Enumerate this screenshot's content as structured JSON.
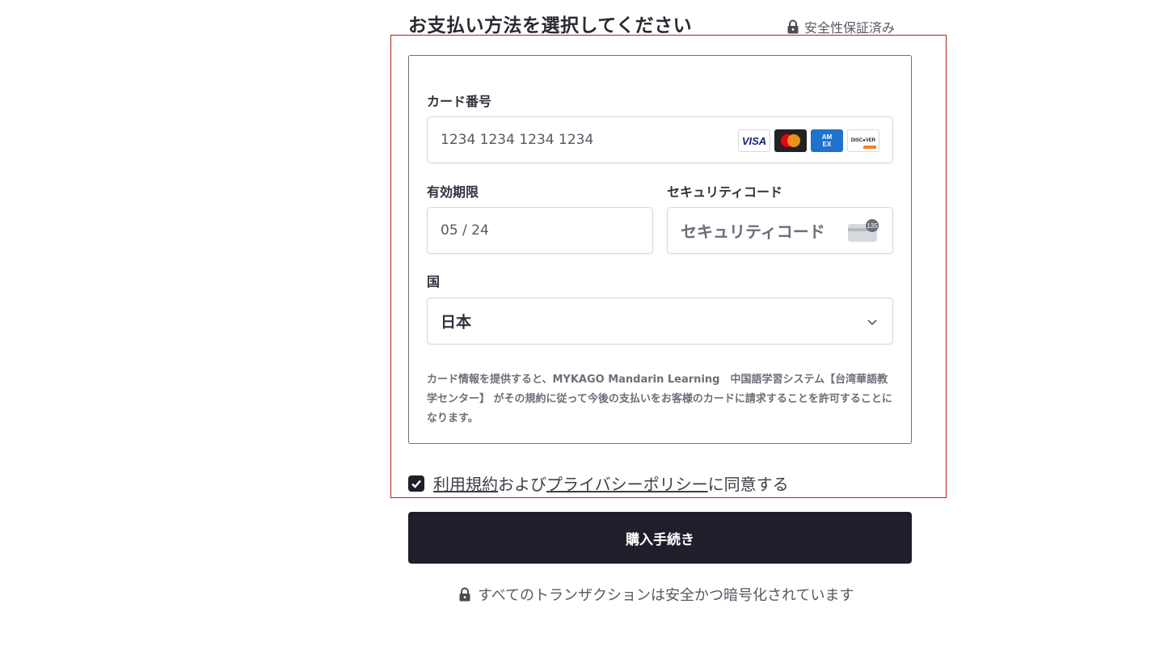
{
  "header": {
    "title": "お支払い方法を選択してください",
    "secure_label": "安全性保証済み"
  },
  "card_form": {
    "card_number_label": "カード番号",
    "card_number_placeholder": "1234 1234 1234 1234",
    "brands": [
      "VISA",
      "mastercard",
      "AMEX",
      "DISCOVER"
    ],
    "expiry_label": "有効期限",
    "expiry_value": "05 / 24",
    "cvc_label": "セキュリティコード",
    "cvc_placeholder": "セキュリティコード",
    "cvc_icon_text": "135",
    "country_label": "国",
    "country_value": "日本",
    "legal_text": "カード情報を提供すると、MYKAGO Mandarin Learning　中国語学習システム【台湾華語教学センター】 がその規約に従って今後の支払いをお客様のカードに請求することを許可することになります。"
  },
  "agreement": {
    "checked": true,
    "terms_link": "利用規約",
    "and_text": "および",
    "privacy_link": "プライバシーポリシー",
    "suffix_text": "に同意する"
  },
  "purchase_button": "購入手続き",
  "footer": {
    "secure_text": "すべてのトランザクションは安全かつ暗号化されています"
  },
  "colors": {
    "primary_dark": "#1f1f2b",
    "frame_red": "#b22222",
    "amex_blue": "#1f72cd"
  }
}
